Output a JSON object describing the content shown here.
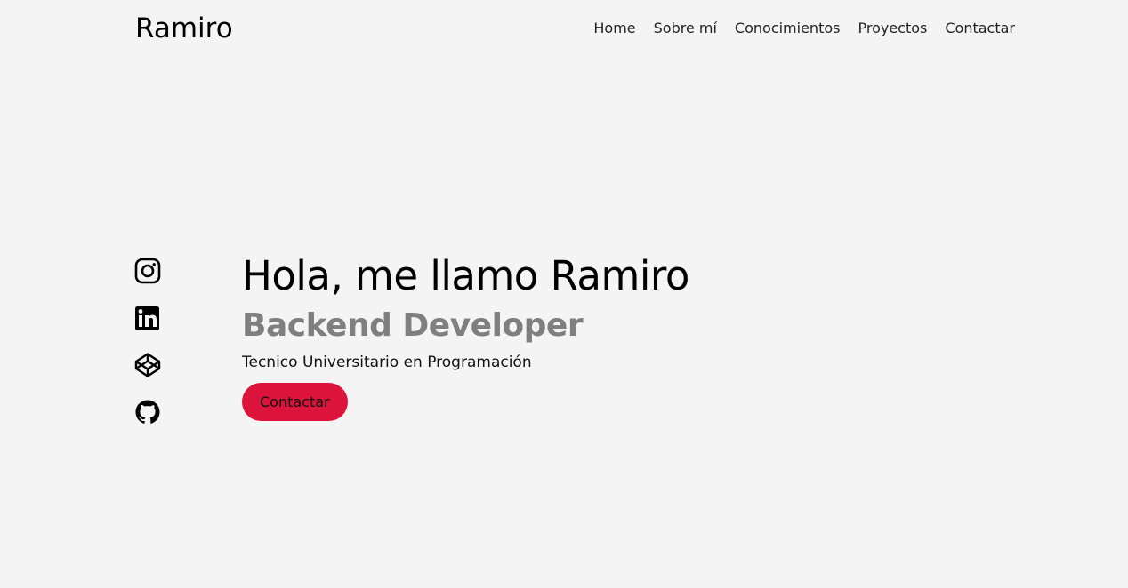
{
  "header": {
    "logo": "Ramiro",
    "nav": [
      {
        "label": "Home"
      },
      {
        "label": "Sobre mí"
      },
      {
        "label": "Conocimientos"
      },
      {
        "label": "Proyectos"
      },
      {
        "label": "Contactar"
      }
    ]
  },
  "social": [
    {
      "icon": "instagram-icon"
    },
    {
      "icon": "linkedin-icon"
    },
    {
      "icon": "codepen-icon"
    },
    {
      "icon": "github-icon"
    }
  ],
  "hero": {
    "title": "Hola, me llamo Ramiro",
    "subtitle": "Backend Developer",
    "description": "Tecnico Universitario en Programación",
    "cta_label": "Contactar"
  },
  "colors": {
    "background": "#f4f4f4",
    "accent": "#dc143c",
    "subtitle": "#7f7f7f"
  }
}
